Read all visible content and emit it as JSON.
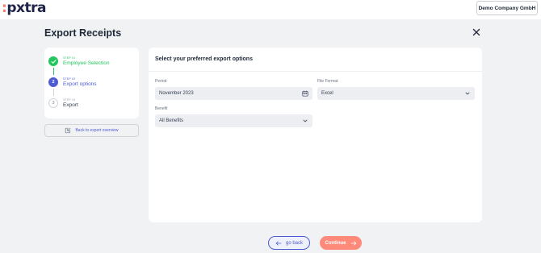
{
  "header": {
    "logo_text": "pxtra",
    "company": "Demo Company GmbH"
  },
  "page": {
    "title": "Export Receipts"
  },
  "steps": [
    {
      "step": "STEP 01",
      "label": "Employee Selection",
      "status": "completed",
      "icon": "check-icon"
    },
    {
      "step": "STEP 02",
      "label": "Export options",
      "status": "active",
      "number": "2"
    },
    {
      "step": "STEP 03",
      "label": "Export",
      "status": "pending",
      "number": "3"
    }
  ],
  "back_to_overview": {
    "label": "Back to export overview",
    "icon": "back-arrow-box-icon"
  },
  "form": {
    "heading": "Select your preferred export options",
    "period": {
      "label": "Period",
      "value": "November 2023",
      "icon": "calendar-icon"
    },
    "file_format": {
      "label": "File Format",
      "value": "Excel",
      "icon": "chevron-down-icon"
    },
    "benefit": {
      "label": "Benefit",
      "value": "All Benefits",
      "icon": "chevron-down-icon"
    }
  },
  "footer": {
    "go_back": "go back",
    "continue": "Continue"
  },
  "colors": {
    "brand_navy": "#1f2347",
    "brand_coral": "#ff7a6b",
    "success": "#22c55e",
    "primary": "#4f5bd5"
  }
}
